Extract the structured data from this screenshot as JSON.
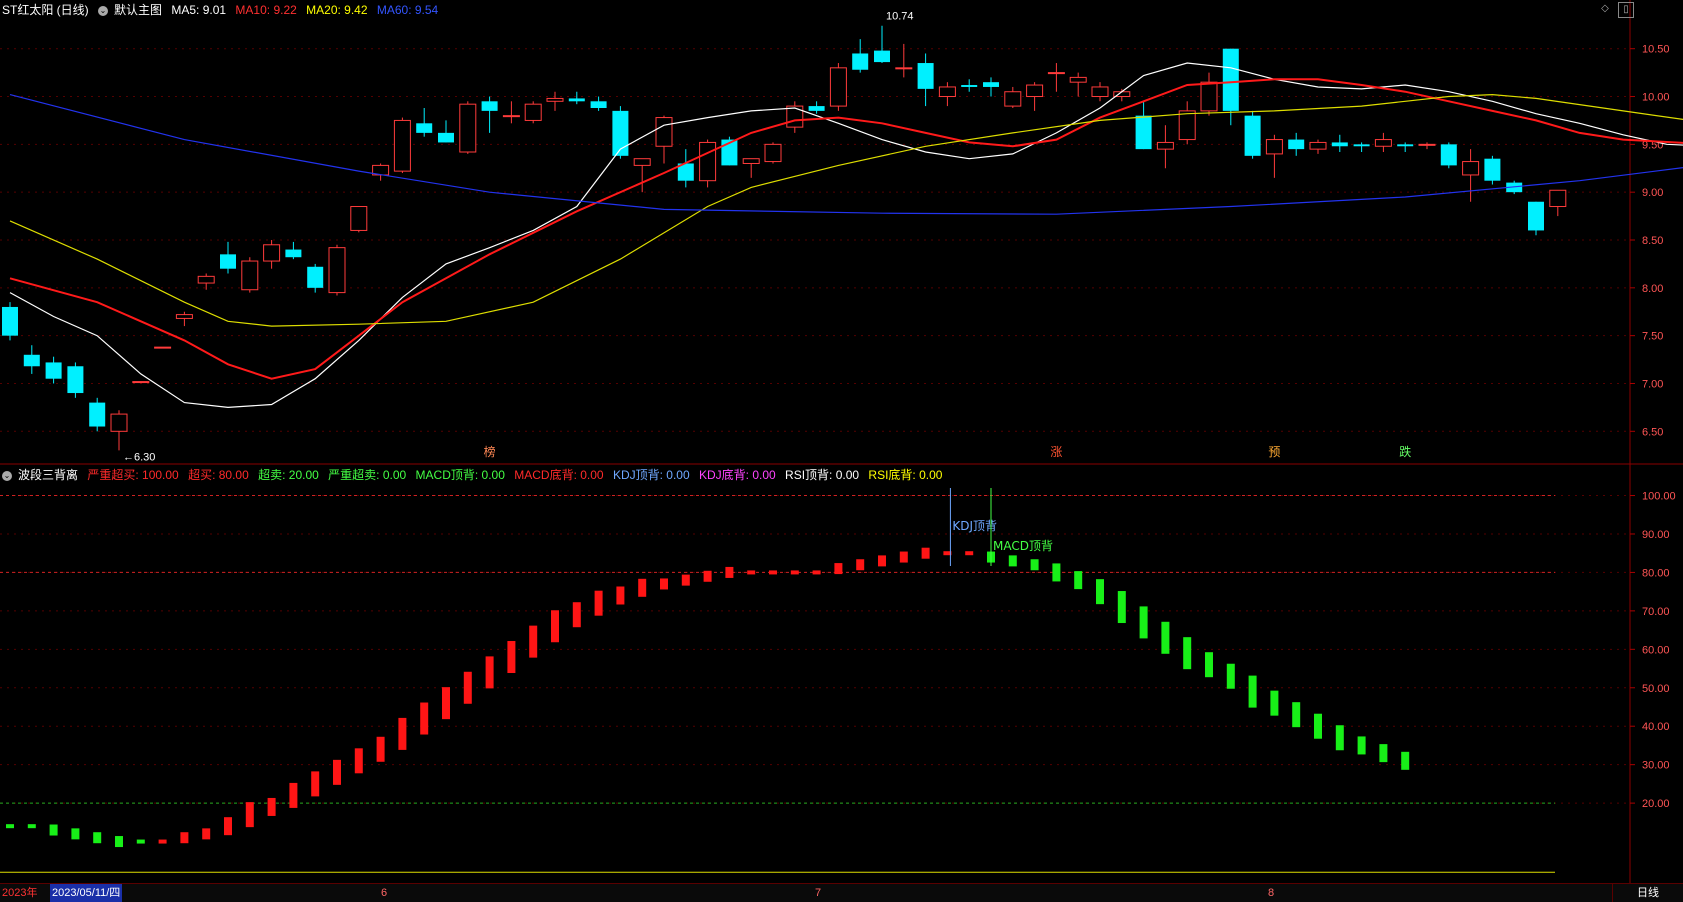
{
  "header": {
    "title": "ST红太阳 (日线)",
    "main_label": "默认主图",
    "ma": [
      {
        "label": "MA5: 9.01",
        "color": "#ffffff"
      },
      {
        "label": "MA10: 9.22",
        "color": "#ff3030"
      },
      {
        "label": "MA20: 9.42",
        "color": "#ffff00"
      },
      {
        "label": "MA60: 9.54",
        "color": "#3355ff"
      }
    ]
  },
  "indicator_header": {
    "title": "波段三背离",
    "items": [
      {
        "label": "严重超买: 100.00",
        "color": "#ff2a2a"
      },
      {
        "label": "超买: 80.00",
        "color": "#ff2a2a"
      },
      {
        "label": "超卖: 20.00",
        "color": "#44ff44"
      },
      {
        "label": "严重超卖: 0.00",
        "color": "#44ff44"
      },
      {
        "label": "MACD顶背: 0.00",
        "color": "#44ff44"
      },
      {
        "label": "MACD底背: 0.00",
        "color": "#ff2a2a"
      },
      {
        "label": "KDJ顶背: 0.00",
        "color": "#6fa8ff"
      },
      {
        "label": "KDJ底背: 0.00",
        "color": "#ff44ff"
      },
      {
        "label": "RSI顶背: 0.00",
        "color": "#ffffff"
      },
      {
        "label": "RSI底背: 0.00",
        "color": "#ffff00"
      }
    ]
  },
  "datebar": {
    "year": "2023年",
    "selected_date": "2023/05/11/四",
    "months": [
      "6",
      "7",
      "8"
    ],
    "period": "日线"
  },
  "chart_data": [
    {
      "type": "candlestick",
      "name": "price",
      "ylim": [
        6.2,
        10.8
      ],
      "yticks": [
        "6.50",
        "7.00",
        "7.50",
        "8.00",
        "8.50",
        "9.00",
        "9.50",
        "10.00",
        "10.50"
      ],
      "candles": [
        [
          7.8,
          7.85,
          7.45,
          7.5
        ],
        [
          7.3,
          7.4,
          7.1,
          7.18
        ],
        [
          7.22,
          7.28,
          7.0,
          7.05
        ],
        [
          7.18,
          7.22,
          6.85,
          6.9
        ],
        [
          6.8,
          6.85,
          6.5,
          6.55
        ],
        [
          6.5,
          6.72,
          6.3,
          6.68
        ],
        [
          7.02,
          7.02,
          7.02,
          7.02
        ],
        [
          7.38,
          7.38,
          7.38,
          7.38
        ],
        [
          7.68,
          7.75,
          7.6,
          7.72
        ],
        [
          8.05,
          8.15,
          7.98,
          8.12
        ],
        [
          8.35,
          8.48,
          8.15,
          8.2
        ],
        [
          7.98,
          8.32,
          7.95,
          8.28
        ],
        [
          8.28,
          8.5,
          8.2,
          8.45
        ],
        [
          8.4,
          8.48,
          8.3,
          8.32
        ],
        [
          8.22,
          8.25,
          7.95,
          8.0
        ],
        [
          7.95,
          8.45,
          7.92,
          8.42
        ],
        [
          8.6,
          8.85,
          8.58,
          8.85
        ],
        [
          9.18,
          9.3,
          9.12,
          9.28
        ],
        [
          9.22,
          9.78,
          9.2,
          9.75
        ],
        [
          9.72,
          9.88,
          9.58,
          9.62
        ],
        [
          9.62,
          9.75,
          9.52,
          9.52
        ],
        [
          9.42,
          9.95,
          9.4,
          9.92
        ],
        [
          9.95,
          10.0,
          9.62,
          9.85
        ],
        [
          9.8,
          9.95,
          9.72,
          9.8
        ],
        [
          9.75,
          9.95,
          9.72,
          9.92
        ],
        [
          9.95,
          10.05,
          9.85,
          9.98
        ],
        [
          9.98,
          10.05,
          9.92,
          9.95
        ],
        [
          9.95,
          10.0,
          9.85,
          9.88
        ],
        [
          9.85,
          9.9,
          9.35,
          9.38
        ],
        [
          9.28,
          9.3,
          9.0,
          9.35
        ],
        [
          9.48,
          9.8,
          9.3,
          9.78
        ],
        [
          9.3,
          9.45,
          9.05,
          9.12
        ],
        [
          9.12,
          9.55,
          9.05,
          9.52
        ],
        [
          9.55,
          9.58,
          9.28,
          9.28
        ],
        [
          9.3,
          9.35,
          9.15,
          9.35
        ],
        [
          9.32,
          9.52,
          9.3,
          9.5
        ],
        [
          9.68,
          9.95,
          9.62,
          9.9
        ],
        [
          9.9,
          9.95,
          9.82,
          9.85
        ],
        [
          9.9,
          10.35,
          9.85,
          10.3
        ],
        [
          10.45,
          10.6,
          10.25,
          10.28
        ],
        [
          10.48,
          10.74,
          10.35,
          10.36
        ],
        [
          10.3,
          10.55,
          10.2,
          10.3
        ],
        [
          10.35,
          10.45,
          9.9,
          10.08
        ],
        [
          10.0,
          10.15,
          9.9,
          10.1
        ],
        [
          10.12,
          10.18,
          10.05,
          10.1
        ],
        [
          10.15,
          10.2,
          10.0,
          10.1
        ],
        [
          9.9,
          10.1,
          9.88,
          10.05
        ],
        [
          10.0,
          10.15,
          9.85,
          10.12
        ],
        [
          10.25,
          10.35,
          10.05,
          10.25
        ],
        [
          10.15,
          10.25,
          10.0,
          10.2
        ],
        [
          10.0,
          10.15,
          9.95,
          10.1
        ],
        [
          10.0,
          10.08,
          9.95,
          10.05
        ],
        [
          9.8,
          9.95,
          9.45,
          9.45
        ],
        [
          9.45,
          9.7,
          9.25,
          9.52
        ],
        [
          9.55,
          9.95,
          9.5,
          9.85
        ],
        [
          9.85,
          10.25,
          9.8,
          10.15
        ],
        [
          10.5,
          10.5,
          9.7,
          9.85
        ],
        [
          9.8,
          9.85,
          9.35,
          9.38
        ],
        [
          9.4,
          9.6,
          9.15,
          9.55
        ],
        [
          9.55,
          9.62,
          9.38,
          9.45
        ],
        [
          9.45,
          9.55,
          9.4,
          9.52
        ],
        [
          9.52,
          9.6,
          9.42,
          9.48
        ],
        [
          9.5,
          9.52,
          9.42,
          9.48
        ],
        [
          9.48,
          9.62,
          9.42,
          9.55
        ],
        [
          9.5,
          9.52,
          9.42,
          9.48
        ],
        [
          9.5,
          9.52,
          9.45,
          9.5
        ],
        [
          9.5,
          9.52,
          9.25,
          9.28
        ],
        [
          9.18,
          9.45,
          8.9,
          9.32
        ],
        [
          9.35,
          9.38,
          9.08,
          9.12
        ],
        [
          9.1,
          9.12,
          8.98,
          9.0
        ],
        [
          8.9,
          8.9,
          8.55,
          8.6
        ],
        [
          8.85,
          9.02,
          8.75,
          9.02
        ]
      ],
      "ma": [
        {
          "name": "MA5",
          "color": "#ffffff",
          "pts": [
            [
              0,
              7.95
            ],
            [
              2,
              7.7
            ],
            [
              4,
              7.5
            ],
            [
              6,
              7.1
            ],
            [
              8,
              6.8
            ],
            [
              10,
              6.75
            ],
            [
              12,
              6.78
            ],
            [
              14,
              7.05
            ],
            [
              16,
              7.45
            ],
            [
              18,
              7.9
            ],
            [
              20,
              8.25
            ],
            [
              22,
              8.42
            ],
            [
              24,
              8.6
            ],
            [
              26,
              8.85
            ],
            [
              28,
              9.45
            ],
            [
              30,
              9.7
            ],
            [
              32,
              9.78
            ],
            [
              34,
              9.85
            ],
            [
              36,
              9.88
            ],
            [
              38,
              9.72
            ],
            [
              40,
              9.55
            ],
            [
              42,
              9.42
            ],
            [
              44,
              9.35
            ],
            [
              46,
              9.4
            ],
            [
              48,
              9.62
            ],
            [
              50,
              9.88
            ],
            [
              52,
              10.22
            ],
            [
              54,
              10.35
            ],
            [
              56,
              10.3
            ],
            [
              58,
              10.18
            ],
            [
              60,
              10.1
            ],
            [
              62,
              10.08
            ],
            [
              64,
              10.12
            ],
            [
              66,
              10.05
            ],
            [
              68,
              9.95
            ],
            [
              70,
              9.82
            ],
            [
              72,
              9.72
            ],
            [
              74,
              9.6
            ],
            [
              76,
              9.5
            ],
            [
              78,
              9.48
            ],
            [
              80,
              9.48
            ],
            [
              82,
              9.42
            ],
            [
              84,
              9.3
            ],
            [
              86,
              9.12
            ],
            [
              88,
              9.01
            ]
          ]
        },
        {
          "name": "MA10",
          "color": "#ff1a1a",
          "pts": [
            [
              0,
              8.1
            ],
            [
              4,
              7.85
            ],
            [
              8,
              7.45
            ],
            [
              10,
              7.2
            ],
            [
              12,
              7.05
            ],
            [
              14,
              7.15
            ],
            [
              16,
              7.5
            ],
            [
              18,
              7.85
            ],
            [
              22,
              8.35
            ],
            [
              26,
              8.8
            ],
            [
              30,
              9.2
            ],
            [
              34,
              9.62
            ],
            [
              36,
              9.75
            ],
            [
              38,
              9.78
            ],
            [
              40,
              9.72
            ],
            [
              42,
              9.62
            ],
            [
              44,
              9.52
            ],
            [
              46,
              9.48
            ],
            [
              48,
              9.55
            ],
            [
              50,
              9.78
            ],
            [
              52,
              9.95
            ],
            [
              54,
              10.12
            ],
            [
              56,
              10.15
            ],
            [
              58,
              10.18
            ],
            [
              60,
              10.18
            ],
            [
              62,
              10.12
            ],
            [
              64,
              10.05
            ],
            [
              66,
              9.95
            ],
            [
              68,
              9.85
            ],
            [
              70,
              9.75
            ],
            [
              72,
              9.62
            ],
            [
              74,
              9.55
            ],
            [
              78,
              9.5
            ],
            [
              82,
              9.42
            ],
            [
              86,
              9.3
            ],
            [
              88,
              9.22
            ]
          ]
        },
        {
          "name": "MA20",
          "color": "#dddd00",
          "pts": [
            [
              0,
              8.7
            ],
            [
              4,
              8.3
            ],
            [
              8,
              7.85
            ],
            [
              10,
              7.65
            ],
            [
              12,
              7.6
            ],
            [
              16,
              7.62
            ],
            [
              20,
              7.65
            ],
            [
              24,
              7.85
            ],
            [
              28,
              8.3
            ],
            [
              32,
              8.85
            ],
            [
              34,
              9.05
            ],
            [
              38,
              9.28
            ],
            [
              42,
              9.48
            ],
            [
              46,
              9.62
            ],
            [
              50,
              9.75
            ],
            [
              54,
              9.82
            ],
            [
              58,
              9.85
            ],
            [
              62,
              9.9
            ],
            [
              64,
              9.95
            ],
            [
              66,
              10.0
            ],
            [
              68,
              10.02
            ],
            [
              70,
              9.98
            ],
            [
              74,
              9.85
            ],
            [
              78,
              9.72
            ],
            [
              82,
              9.62
            ],
            [
              86,
              9.5
            ],
            [
              88,
              9.42
            ]
          ]
        },
        {
          "name": "MA60",
          "color": "#2233ee",
          "pts": [
            [
              0,
              10.02
            ],
            [
              8,
              9.55
            ],
            [
              16,
              9.22
            ],
            [
              22,
              9.0
            ],
            [
              30,
              8.82
            ],
            [
              40,
              8.78
            ],
            [
              48,
              8.77
            ],
            [
              56,
              8.85
            ],
            [
              64,
              8.95
            ],
            [
              72,
              9.12
            ],
            [
              80,
              9.35
            ],
            [
              88,
              9.54
            ]
          ]
        }
      ],
      "annotations": [
        {
          "i": 5,
          "y": 6.3,
          "text": "←6.30"
        },
        {
          "i": 40,
          "y": 10.74,
          "text": "10.74"
        }
      ],
      "markers": [
        {
          "i": 22,
          "text": "榜",
          "color": "#ff8855"
        },
        {
          "i": 48,
          "text": "涨",
          "color": "#ff5533"
        },
        {
          "i": 58,
          "text": "预",
          "color": "#ffaa33"
        },
        {
          "i": 64,
          "text": "跌",
          "color": "#66ff66"
        }
      ]
    },
    {
      "type": "bar",
      "name": "波段三背离",
      "ylim": [
        0,
        103
      ],
      "yticks": [
        "20.00",
        "30.00",
        "40.00",
        "50.00",
        "60.00",
        "70.00",
        "80.00",
        "90.00",
        "100.00"
      ],
      "hlines": [
        {
          "y": 100,
          "color": "#cc2222"
        },
        {
          "y": 80,
          "color": "#cc2222"
        },
        {
          "y": 20,
          "color": "#22aa22"
        },
        {
          "y": 2,
          "color": "#dddd00"
        }
      ],
      "values": [
        14,
        14,
        13,
        12,
        11,
        10,
        10,
        10,
        11,
        12,
        14,
        17,
        19,
        22,
        25,
        28,
        31,
        34,
        38,
        42,
        46,
        50,
        54,
        58,
        62,
        66,
        69,
        72,
        74,
        76,
        77,
        78,
        79,
        80,
        80,
        80,
        80,
        80,
        81,
        82,
        83,
        84,
        85,
        85,
        85,
        84,
        83,
        82,
        80,
        78,
        75,
        71,
        67,
        63,
        59,
        56,
        53,
        49,
        46,
        43,
        40,
        37,
        35,
        33,
        31
      ],
      "colors": [
        "g",
        "g",
        "g",
        "g",
        "g",
        "g",
        "g",
        "r",
        "r",
        "r",
        "r",
        "r",
        "r",
        "r",
        "r",
        "r",
        "r",
        "r",
        "r",
        "r",
        "r",
        "r",
        "r",
        "r",
        "r",
        "r",
        "r",
        "r",
        "r",
        "r",
        "r",
        "r",
        "r",
        "r",
        "r",
        "r",
        "r",
        "r",
        "r",
        "r",
        "r",
        "r",
        "r",
        "r",
        "r",
        "g",
        "g",
        "g",
        "g",
        "g",
        "g",
        "g",
        "g",
        "g",
        "g",
        "g",
        "g",
        "g",
        "g",
        "g",
        "g",
        "g",
        "g",
        "g",
        "g"
      ],
      "annotations": [
        {
          "i": 43,
          "text": "KDJ顶背",
          "color": "#6fa8ff"
        },
        {
          "i": 45,
          "text": "MACD顶背",
          "color": "#44ff44"
        }
      ]
    }
  ]
}
